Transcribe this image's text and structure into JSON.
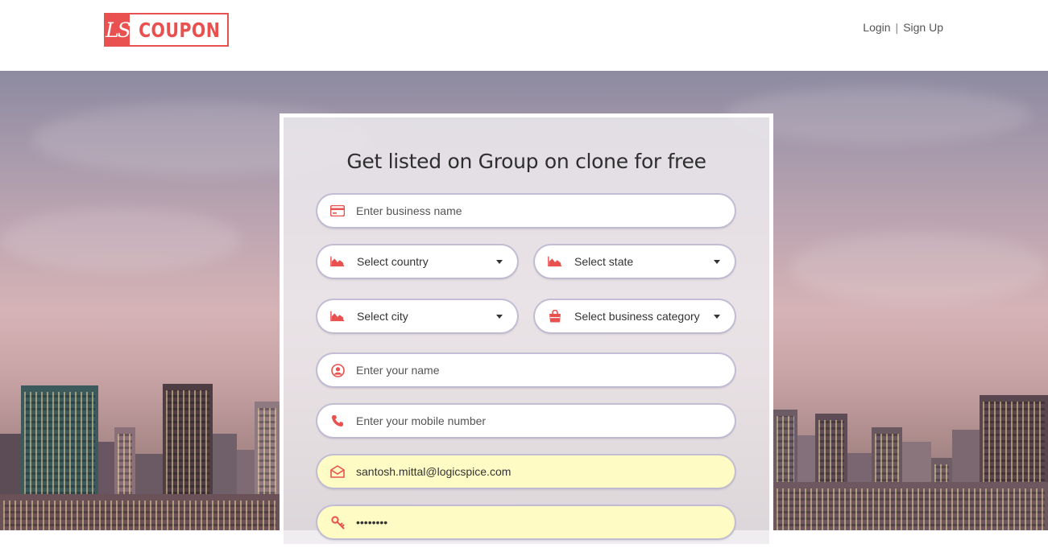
{
  "header": {
    "logo_mark": "LS",
    "logo_text": "COUPON",
    "login_label": "Login",
    "separator": "|",
    "signup_label": "Sign Up"
  },
  "form": {
    "title": "Get listed on Group on clone for free",
    "business_name": {
      "placeholder": "Enter business name",
      "value": "",
      "icon": "card-icon"
    },
    "country": {
      "label": "Select country",
      "icon": "area-chart-icon"
    },
    "state": {
      "label": "Select state",
      "icon": "area-chart-icon"
    },
    "city": {
      "label": "Select city",
      "icon": "area-chart-icon"
    },
    "category": {
      "label": "Select business category",
      "icon": "shopping-bag-icon"
    },
    "name": {
      "placeholder": "Enter your name",
      "value": "",
      "icon": "user-circle-icon"
    },
    "mobile": {
      "placeholder": "Enter your mobile number",
      "value": "",
      "icon": "phone-icon"
    },
    "email": {
      "value": "santosh.mittal@logicspice.com",
      "icon": "envelope-icon"
    },
    "password": {
      "value": "password",
      "icon": "key-icon"
    }
  },
  "colors": {
    "accent": "#e8514f",
    "autofill": "#fefcc4"
  }
}
